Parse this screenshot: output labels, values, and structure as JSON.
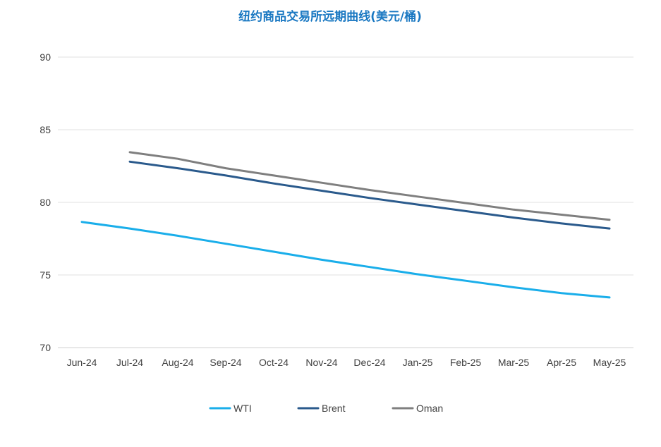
{
  "chart_data": {
    "type": "line",
    "title": "纽约商品交易所远期曲线(美元/桶)",
    "categories": [
      "Jun-24",
      "Jul-24",
      "Aug-24",
      "Sep-24",
      "Oct-24",
      "Nov-24",
      "Dec-24",
      "Jan-25",
      "Feb-25",
      "Mar-25",
      "Apr-25",
      "May-25"
    ],
    "ylim": [
      70,
      90
    ],
    "yticks": [
      70,
      75,
      80,
      85,
      90
    ],
    "grid": true,
    "legend_position": "bottom",
    "series": [
      {
        "name": "WTI",
        "color": "#1aaeea",
        "values": [
          78.65,
          78.2,
          77.7,
          77.15,
          76.6,
          76.05,
          75.55,
          75.05,
          74.6,
          74.15,
          73.75,
          73.45
        ]
      },
      {
        "name": "Brent",
        "color": "#2a5a8c",
        "values": [
          null,
          82.8,
          82.35,
          81.85,
          81.3,
          80.8,
          80.3,
          79.85,
          79.4,
          78.95,
          78.55,
          78.2
        ]
      },
      {
        "name": "Oman",
        "color": "#7f7f7f",
        "values": [
          null,
          83.45,
          83.0,
          82.35,
          81.85,
          81.35,
          80.85,
          80.4,
          79.95,
          79.5,
          79.15,
          78.8
        ]
      }
    ],
    "title_color": "#1a78c2"
  }
}
